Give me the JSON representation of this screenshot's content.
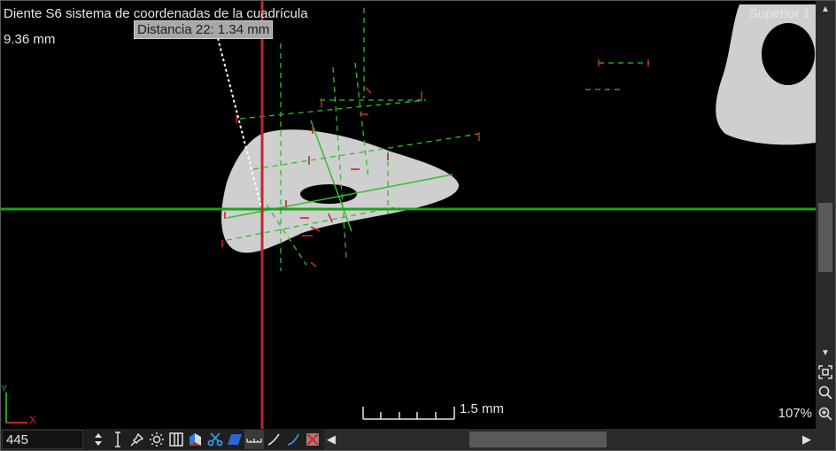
{
  "viewer": {
    "title": "Diente S6 sistema de coordenadas de la cuadrícula",
    "depth": "9.36 mm",
    "view_name": "Superior 1",
    "zoom": "107%"
  },
  "measurement": {
    "label": "Distancia 22: 1.34 mm"
  },
  "scale_bar": {
    "label": "1.5 mm"
  },
  "axes": {
    "x_label": "X",
    "y_label": "Y"
  },
  "toolbar": {
    "slice_value": "445"
  },
  "colors": {
    "crosshair_horizontal": "#1ea01e",
    "crosshair_vertical": "#c0282d",
    "grid_green": "#2fbf2f",
    "grid_red": "#c0282d",
    "tooth_gray": "#cfcfcf",
    "viewport_background": "#000000"
  }
}
